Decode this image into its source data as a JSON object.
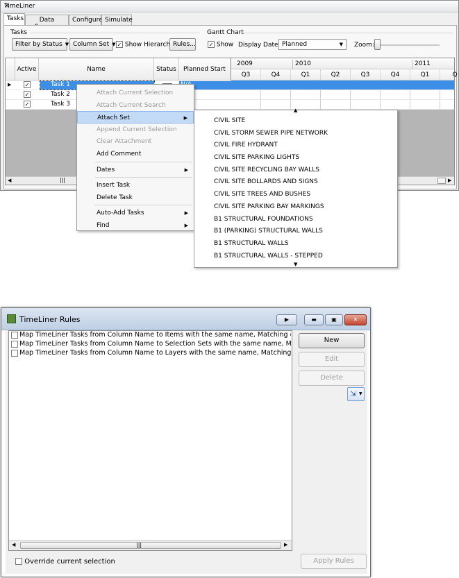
{
  "timeliner": {
    "title": "TimeLiner",
    "close_glyph": "✕",
    "tabs": [
      "Tasks",
      "Data Sources",
      "Configure",
      "Simulate"
    ],
    "tasks_group": "Tasks",
    "filter_button": "Filter by Status",
    "column_set_button": "Column Set",
    "show_hierarchy_label": "Show Hierarchy",
    "show_hierarchy_checked": true,
    "rules_button": "Rules...",
    "gantt_group": "Gantt Chart",
    "show_label": "Show",
    "show_checked": true,
    "display_dates_label": "Display Dates:",
    "display_dates_value": "Planned",
    "zoom_label": "Zoom:",
    "columns": [
      "Active",
      "Name",
      "Status",
      "Planned Start"
    ],
    "years": [
      "2009",
      "2010",
      "2011"
    ],
    "quarters": [
      "Q3",
      "Q4",
      "Q1",
      "Q2",
      "Q3",
      "Q4",
      "Q1",
      "Q"
    ],
    "rows": [
      {
        "active": true,
        "name": "Task 1",
        "planned_start": "N/A",
        "selected": true
      },
      {
        "active": true,
        "name": "Task 2",
        "planned_start": "",
        "selected": false
      },
      {
        "active": true,
        "name": "Task 3",
        "planned_start": "",
        "selected": false
      }
    ]
  },
  "context_menu": {
    "items": [
      {
        "label": "Attach Current Selection",
        "disabled": true
      },
      {
        "label": "Attach Current Search",
        "disabled": true
      },
      {
        "label": "Attach Set",
        "disabled": false,
        "submenu": true,
        "highlighted": true
      },
      {
        "label": "Append Current Selection",
        "disabled": true
      },
      {
        "label": "Clear Attachment",
        "disabled": true
      },
      {
        "label": "Add Comment",
        "disabled": false
      },
      {
        "separator": true
      },
      {
        "label": "Dates",
        "disabled": false,
        "submenu": true
      },
      {
        "separator": true
      },
      {
        "label": "Insert Task",
        "disabled": false
      },
      {
        "label": "Delete Task",
        "disabled": false
      },
      {
        "separator": true
      },
      {
        "label": "Auto-Add Tasks",
        "disabled": false,
        "submenu": true
      },
      {
        "label": "Find",
        "disabled": false,
        "submenu": true
      }
    ]
  },
  "attach_set_submenu": [
    "CIVIL SITE",
    "CIVIL STORM SEWER PIPE NETWORK",
    "CIVIL FIRE HYDRANT",
    "CIVIL SITE PARKING LIGHTS",
    "CIVIL SITE RECYCLING BAY WALLS",
    "CIVIL SITE BOLLARDS AND SIGNS",
    "CIVIL SITE TREES AND BUSHES",
    "CIVIL SITE PARKING BAY MARKINGS",
    "B1 STRUCTURAL FOUNDATIONS",
    "B1 (PARKING) STRUCTURAL WALLS",
    "B1 STRUCTURAL WALLS",
    "B1 STRUCTURAL WALLS - STEPPED"
  ],
  "rules_dialog": {
    "title": "TimeLiner Rules",
    "rules": [
      "Map TimeLiner Tasks from Column Name to Items with the same name, Matching case",
      "Map TimeLiner Tasks from Column Name to Selection Sets with the same name, Matching case",
      "Map TimeLiner Tasks from Column Name to Layers with the same name, Matching case"
    ],
    "new_button": "New",
    "edit_button": "Edit",
    "delete_button": "Delete",
    "override_label": "Override current selection",
    "apply_button": "Apply Rules"
  }
}
